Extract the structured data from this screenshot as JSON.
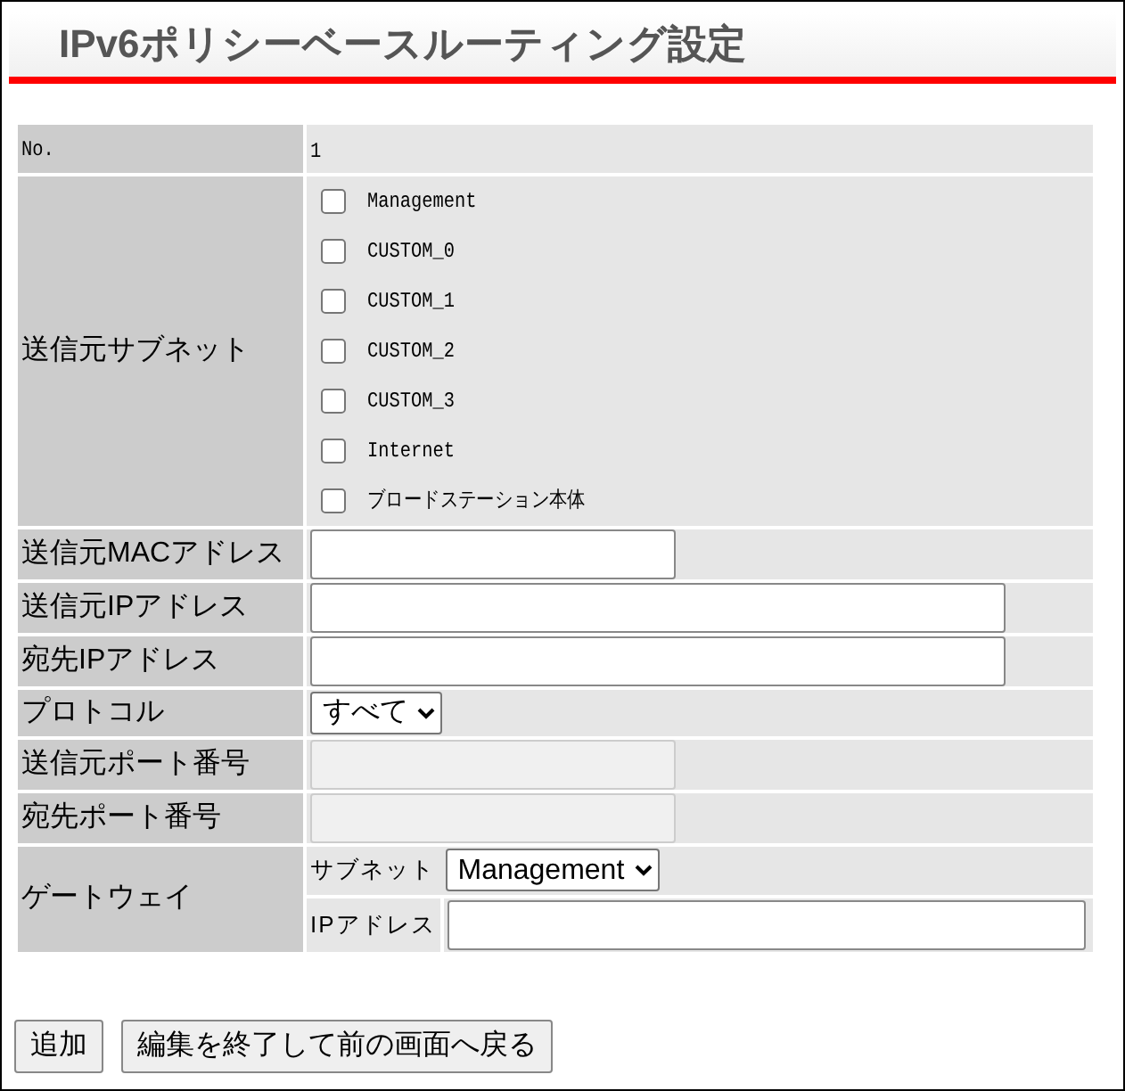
{
  "title": "IPv6ポリシーベースルーティング設定",
  "rows": [
    {
      "kind": "text",
      "label": "No.",
      "value": "1"
    },
    {
      "kind": "checkboxes",
      "label": "送信元サブネット",
      "options": [
        {
          "label": "Management",
          "checked": false
        },
        {
          "label": "CUSTOM_0",
          "checked": false
        },
        {
          "label": "CUSTOM_1",
          "checked": false
        },
        {
          "label": "CUSTOM_2",
          "checked": false
        },
        {
          "label": "CUSTOM_3",
          "checked": false
        },
        {
          "label": "Internet",
          "checked": false
        },
        {
          "label": "ブロードステーション本体",
          "checked": false
        }
      ]
    },
    {
      "kind": "input",
      "label": "送信元MACアドレス",
      "wide": false,
      "disabled": false
    },
    {
      "kind": "input",
      "label": "送信元IPアドレス",
      "wide": true,
      "disabled": false
    },
    {
      "kind": "input",
      "label": "宛先IPアドレス",
      "wide": true,
      "disabled": false
    },
    {
      "kind": "select",
      "label": "プロトコル",
      "value": "すべて"
    },
    {
      "kind": "input",
      "label": "送信元ポート番号",
      "wide": false,
      "disabled": true
    },
    {
      "kind": "input",
      "label": "宛先ポート番号",
      "wide": false,
      "disabled": true
    },
    {
      "kind": "gateway",
      "label": "ゲートウェイ",
      "subnet_label": "サブネット",
      "subnet_value": "Management",
      "ip_label": "IPアドレス"
    }
  ],
  "buttons": [
    "追加",
    "編集を終了して前の画面へ戻る"
  ]
}
